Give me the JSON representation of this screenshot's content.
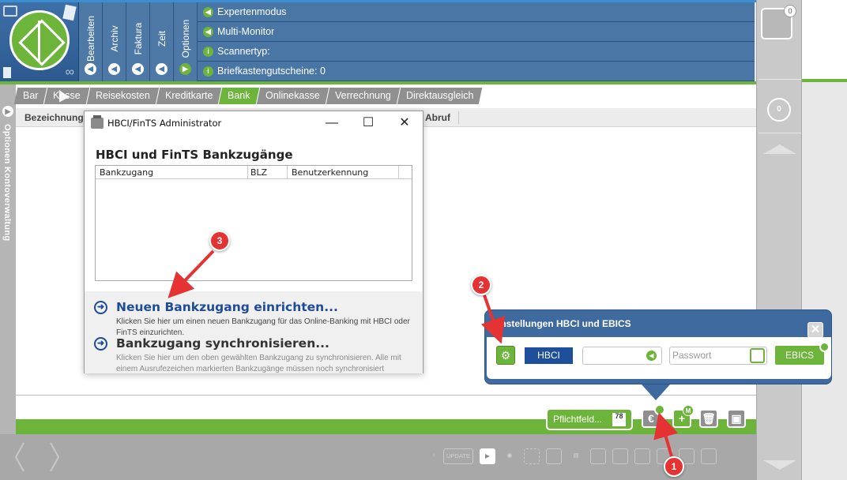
{
  "header": {
    "vertical_menu": [
      {
        "label": "Bearbeiten"
      },
      {
        "label": "Archiv"
      },
      {
        "label": "Faktura"
      },
      {
        "label": "Zeit"
      },
      {
        "label": "Optionen"
      }
    ],
    "info_lines": [
      {
        "label": "Expertenmodus"
      },
      {
        "label": "Multi-Monitor"
      },
      {
        "label": "Scannertyp:"
      },
      {
        "label": "Briefkastengutscheine: 0"
      }
    ]
  },
  "right_column": {
    "mail_count": "0",
    "counter": "0"
  },
  "sidebar": {
    "label": "Optionen  Kontoverwaltung"
  },
  "tabs": [
    {
      "label": "Bar"
    },
    {
      "label": "Kasse"
    },
    {
      "label": "Reisekosten"
    },
    {
      "label": "Kreditkarte"
    },
    {
      "label": "Bank",
      "active": true
    },
    {
      "label": "Onlinekasse"
    },
    {
      "label": "Verrechnung"
    },
    {
      "label": "Direktausgleich"
    }
  ],
  "list_header": {
    "col1": "Bezeichnung",
    "col2": "Abruf"
  },
  "dialog": {
    "title": "HBCI/FinTS Administrator",
    "heading": "HBCI und FinTS Bankzugänge",
    "columns": [
      "Bankzugang",
      "BLZ",
      "Benutzerkennung"
    ],
    "actions": [
      {
        "title": "Neuen Bankzugang einrichten...",
        "desc": "Klicken Sie hier um einen neuen Bankzugang für das Online-Banking mit HBCI oder FinTS einzurichten."
      },
      {
        "title": "Bankzugang synchronisieren...",
        "desc": "Klicken Sie hier um den oben gewählten Bankzugang zu synchronisieren. Alle mit einem Ausrufezeichen markierten Bankzugänge müssen noch synchronisiert"
      }
    ]
  },
  "popup": {
    "title": "Einstellungen HBCI und EBICS",
    "hbci_label": "HBCI",
    "account_value": "",
    "password_placeholder": "Passwort",
    "ebics_label": "EBICS"
  },
  "footer": {
    "pflichtfeld_label": "Pflichtfeld...",
    "pflichtfeld_badge": "78",
    "update_label": "UPDATE"
  },
  "markers": [
    "1",
    "2",
    "3"
  ],
  "colors": {
    "accent_green": "#6db53a",
    "header_blue": "#4a76a6",
    "dialog_link": "#1f4c97",
    "marker_red": "#e53232"
  }
}
